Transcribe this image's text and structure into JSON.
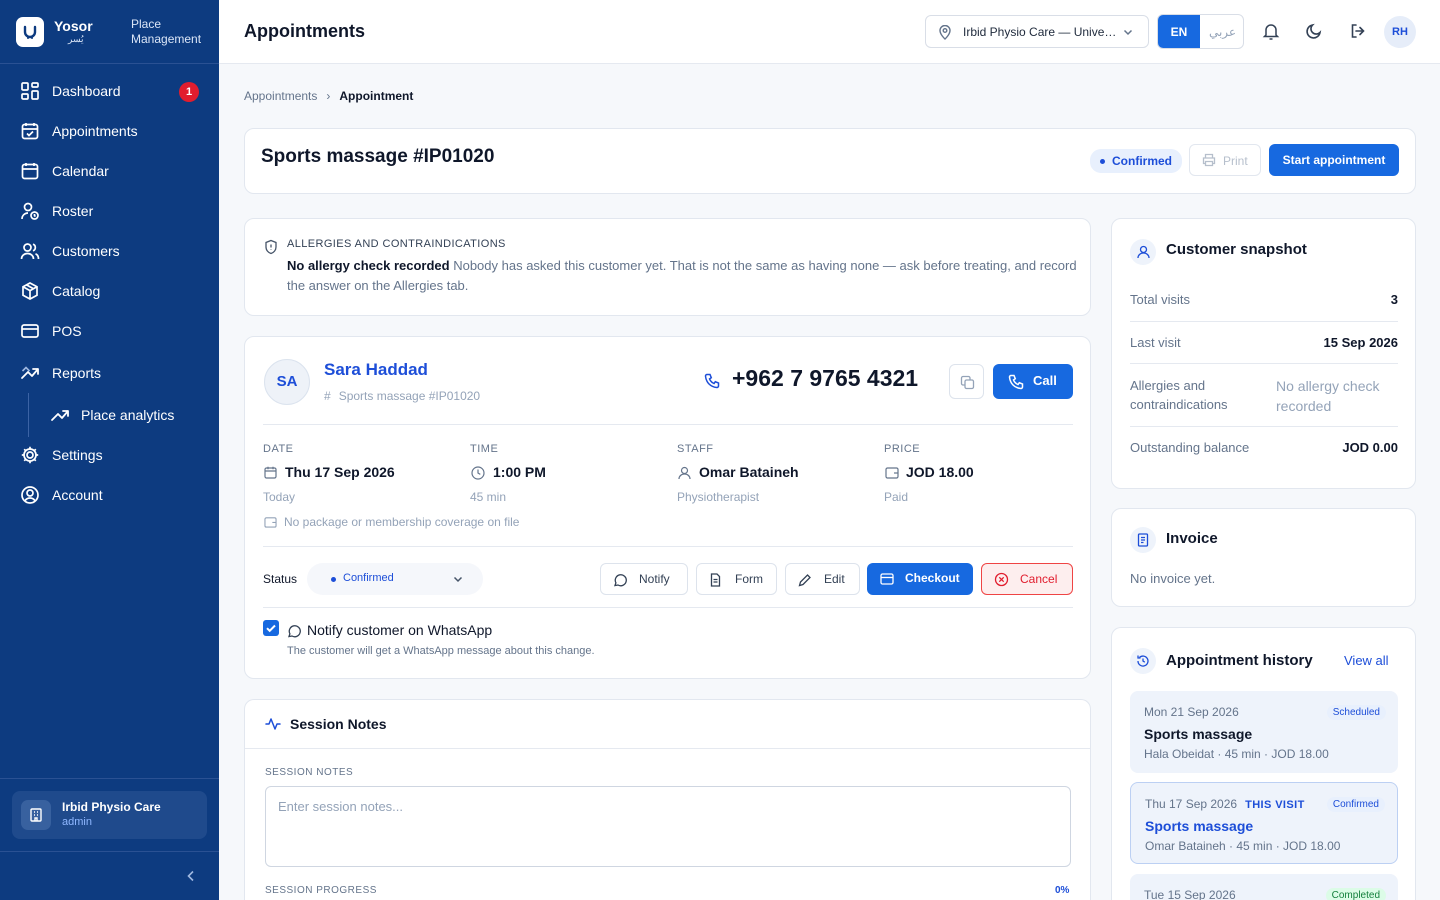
{
  "brand": {
    "name": "Yosor",
    "name_ar": "يُسر",
    "subtitle": "Place Management"
  },
  "sidebar": {
    "items": [
      {
        "label": "Dashboard",
        "badge": "1"
      },
      {
        "label": "Appointments"
      },
      {
        "label": "Calendar"
      },
      {
        "label": "Roster"
      },
      {
        "label": "Customers"
      },
      {
        "label": "Catalog"
      },
      {
        "label": "POS"
      },
      {
        "label": "Reports"
      },
      {
        "label": "Place analytics"
      },
      {
        "label": "Settings"
      },
      {
        "label": "Account"
      }
    ],
    "place": {
      "name": "Irbid Physio Care",
      "role": "admin"
    }
  },
  "topbar": {
    "title": "Appointments",
    "location": "Irbid Physio Care — University Street",
    "lang_en": "EN",
    "lang_ar": "عربي",
    "avatar": "RH"
  },
  "breadcrumb": {
    "parent": "Appointments",
    "current": "Appointment"
  },
  "header": {
    "title": "Sports massage #IP01020",
    "status": "Confirmed",
    "print_label": "Print",
    "start_label": "Start appointment"
  },
  "allergy": {
    "title": "ALLERGIES AND CONTRAINDICATIONS",
    "bold": "No allergy check recorded",
    "text": "Nobody has asked this customer yet. That is not the same as having none — ask before treating, and record the answer on the Allergies tab."
  },
  "appointment": {
    "initials": "SA",
    "customer": "Sara Haddad",
    "ref": "Sports massage  #IP01020",
    "phone": "+962 7 9765 4321",
    "call_label": "Call",
    "date_label": "DATE",
    "date": "Thu 17 Sep 2026",
    "date_sub": "Today",
    "time_label": "TIME",
    "time": "1:00 PM",
    "time_sub": "45 min",
    "staff_label": "STAFF",
    "staff": "Omar Bataineh",
    "staff_sub": "Physiotherapist",
    "price_label": "PRICE",
    "price": "JOD 18.00",
    "price_sub": "Paid",
    "coverage": "No package or membership coverage on file",
    "status_label": "Status",
    "status_value": "Confirmed",
    "actions": {
      "notify": "Notify",
      "form": "Form",
      "edit": "Edit",
      "checkout": "Checkout",
      "cancel": "Cancel"
    },
    "whatsapp_label": "Notify customer on WhatsApp",
    "whatsapp_sub": "The customer will get a WhatsApp message about this change.",
    "whatsapp_checked": true
  },
  "notes": {
    "title": "Session Notes",
    "field_label": "SESSION NOTES",
    "placeholder": "Enter session notes...",
    "progress_label": "SESSION PROGRESS",
    "progress": "0%"
  },
  "snapshot": {
    "title": "Customer snapshot",
    "rows": [
      {
        "k": "Total visits",
        "v": "3"
      },
      {
        "k": "Last visit",
        "v": "15 Sep 2026"
      },
      {
        "k": "Allergies and contraindications",
        "v": "No allergy check recorded"
      },
      {
        "k": "Outstanding balance",
        "v": "JOD 0.00"
      }
    ]
  },
  "invoice": {
    "title": "Invoice",
    "empty": "No invoice yet."
  },
  "history": {
    "title": "Appointment history",
    "view_all": "View all",
    "items": [
      {
        "date": "Mon 21 Sep 2026",
        "service": "Sports massage",
        "meta": "Hala Obeidat · 45 min · JOD 18.00",
        "status": "Scheduled"
      },
      {
        "date": "Thu 17 Sep 2026",
        "tag": "THIS VISIT",
        "service": "Sports massage",
        "meta": "Omar Bataineh · 45 min · JOD 18.00",
        "status": "Confirmed"
      },
      {
        "date": "Tue 15 Sep 2026",
        "status": "Completed"
      }
    ]
  },
  "colors": {
    "sidebar": "#0d3b80",
    "primary": "#1769e0",
    "danger": "#e11d2e"
  }
}
